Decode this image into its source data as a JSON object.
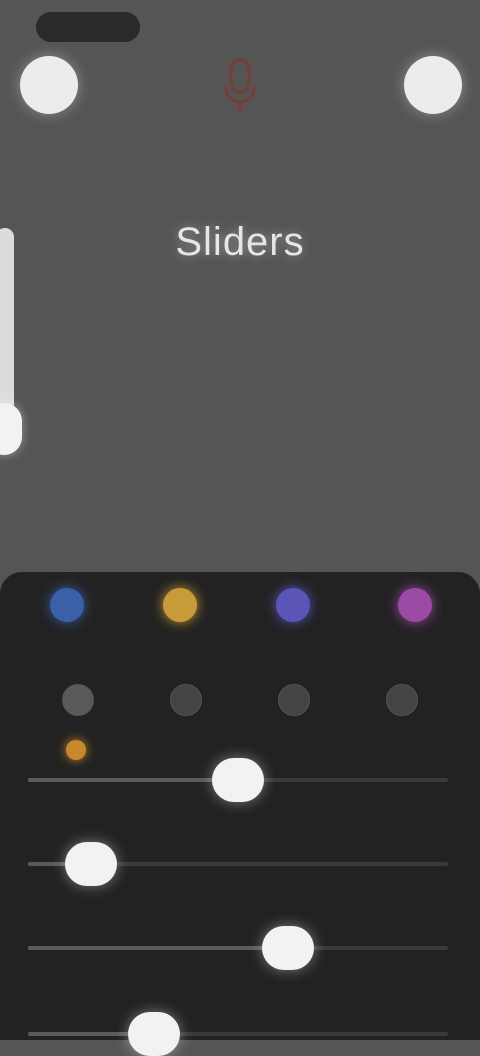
{
  "title": "Sliders",
  "status": {
    "right_text": ""
  },
  "colors": {
    "swatches": [
      "#3b5fa8",
      "#c79a3a",
      "#5b55b8",
      "#9b4aa6"
    ],
    "accent": "#c8892e",
    "background": "#555555",
    "panel": "#222222"
  },
  "icons": {
    "left_button": "circle-button-icon",
    "right_button": "circle-button-icon",
    "center": "microphone-icon",
    "modes": [
      "mode-icon-1",
      "mode-icon-2",
      "mode-icon-3",
      "mode-icon-4"
    ]
  },
  "vertical_slider": {
    "value": 0.93
  },
  "sliders": [
    {
      "label": "",
      "value_text": "",
      "value": 0.5
    },
    {
      "label": "",
      "value_text": "",
      "value": 0.15
    },
    {
      "label": "",
      "value_text": "",
      "value": 0.62
    },
    {
      "label": "",
      "value_text": "",
      "value": 0.3
    }
  ]
}
